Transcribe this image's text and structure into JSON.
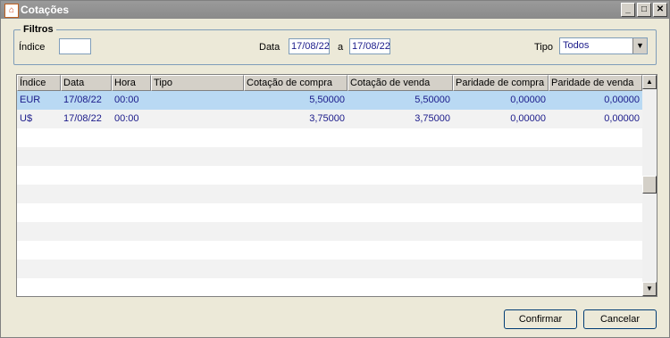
{
  "window": {
    "title": "Cotações",
    "minimize": "_",
    "maximize": "□",
    "close": "✕"
  },
  "filters": {
    "legend": "Filtros",
    "indice_label": "Índice",
    "indice_value": "",
    "data_label": "Data",
    "date_from": "17/08/22",
    "a_label": "a",
    "date_to": "17/08/22",
    "tipo_label": "Tipo",
    "tipo_value": "Todos"
  },
  "table": {
    "columns": [
      "Índice",
      "Data",
      "Hora",
      "Tipo",
      "Cotação de compra",
      "Cotação de venda",
      "Paridade de compra",
      "Paridade de venda"
    ],
    "rows": [
      [
        "EUR",
        "17/08/22",
        "00:00",
        "",
        "5,50000",
        "5,50000",
        "0,00000",
        "0,00000"
      ],
      [
        "U$",
        "17/08/22",
        "00:00",
        "",
        "3,75000",
        "3,75000",
        "0,00000",
        "0,00000"
      ]
    ],
    "selected_row": 0
  },
  "buttons": {
    "confirm": "Confirmar",
    "cancel": "Cancelar"
  },
  "colors": {
    "selected_row": "#b9d9f3",
    "text": "#1a1a8a"
  }
}
